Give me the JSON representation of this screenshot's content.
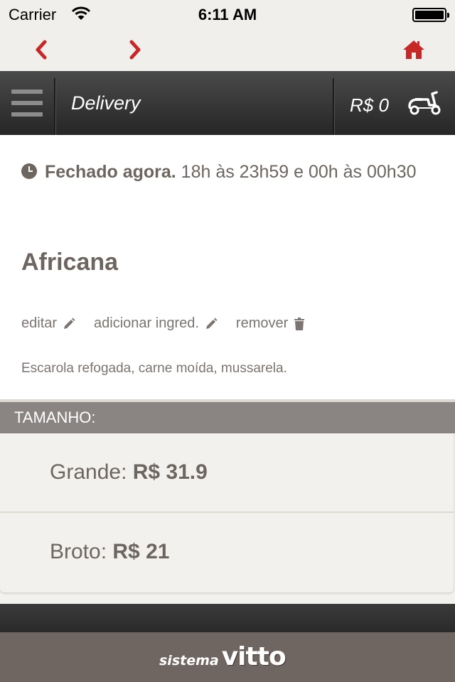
{
  "status_bar": {
    "carrier": "Carrier",
    "time": "6:11 AM"
  },
  "nav": {
    "back_icon": "chevron-left-icon",
    "forward_icon": "chevron-right-icon",
    "home_icon": "home-icon",
    "accent_color": "#c62828"
  },
  "header": {
    "title": "Delivery",
    "cart_total": "R$ 0",
    "menu_icon": "hamburger-menu-icon",
    "delivery_icon": "scooter-icon"
  },
  "store": {
    "status": "Fechado agora.",
    "hours": "18h às 23h59 e 00h às 00h30"
  },
  "product": {
    "name": "Africana",
    "actions": [
      {
        "label": "editar",
        "icon": "pencil-icon"
      },
      {
        "label": "adicionar ingred.",
        "icon": "pencil-icon"
      },
      {
        "label": "remover",
        "icon": "trash-icon"
      }
    ],
    "description": "Escarola refogada, carne moída, mussarela."
  },
  "sizes": {
    "header": "TAMANHO:",
    "options": [
      {
        "label": "Grande:",
        "price": "R$ 31.9"
      },
      {
        "label": "Broto:",
        "price": "R$ 21"
      }
    ]
  },
  "footer": {
    "brand_small": "sistema",
    "brand_big": "vitto"
  }
}
